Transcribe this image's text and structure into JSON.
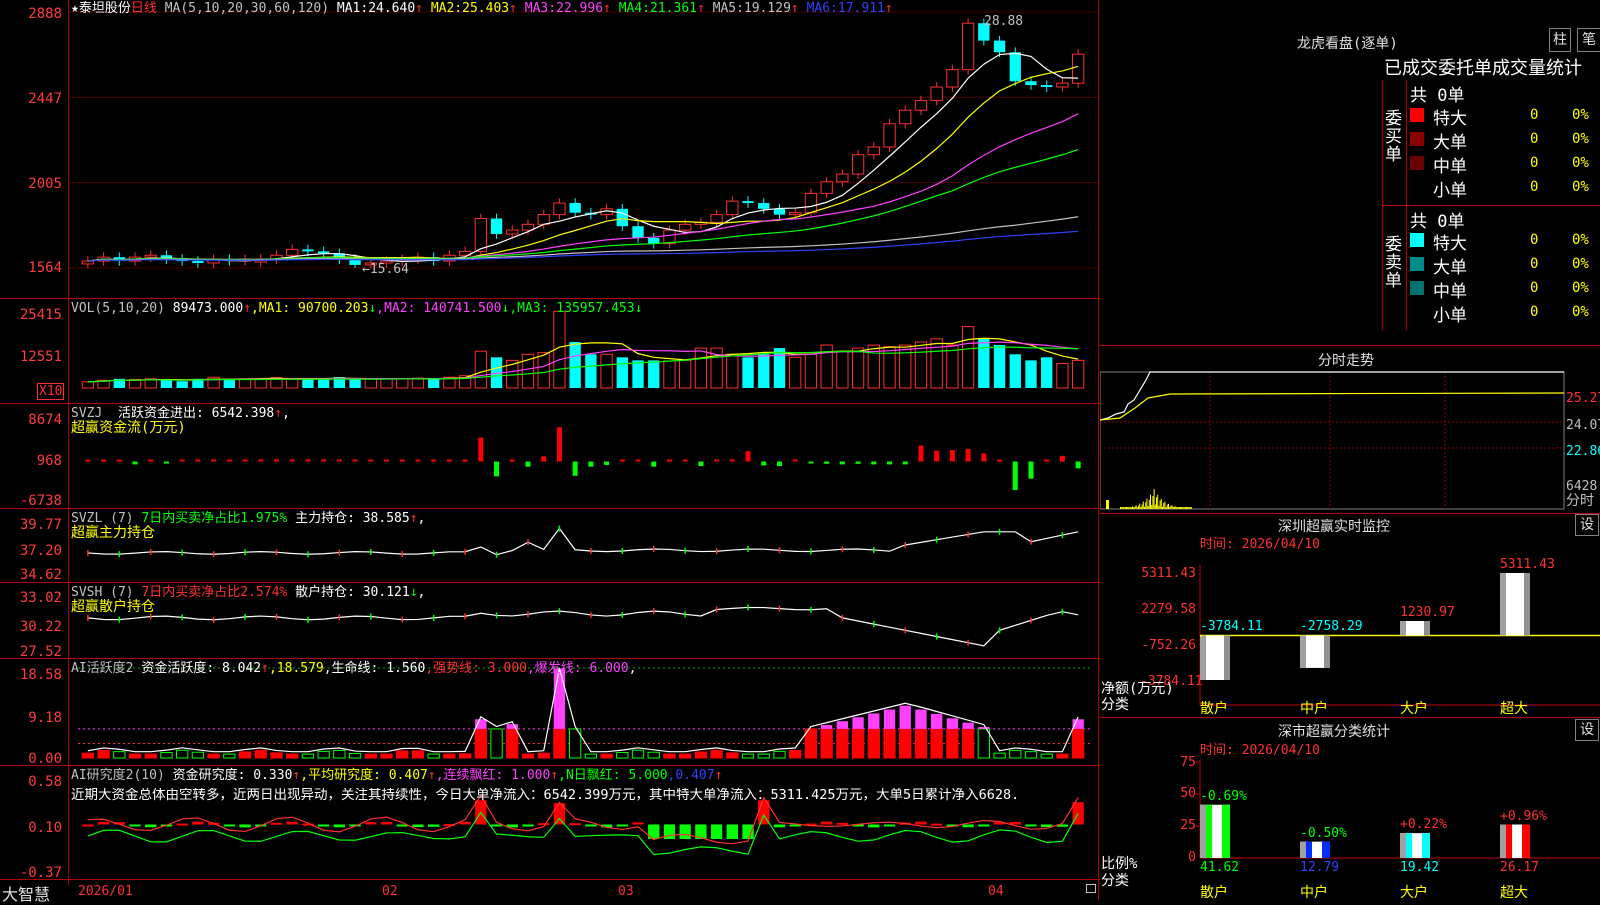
{
  "main": {
    "star": "★",
    "stock_name": "泰坦股份",
    "period": "日线",
    "ma_label": "MA(5,10,20,30,60,120)",
    "ma": [
      {
        "name": "MA1:",
        "value": "24.640",
        "arrow": "↑",
        "color": "#ffffff"
      },
      {
        "name": "MA2:",
        "value": "25.403",
        "arrow": "↑",
        "color": "#ffff00"
      },
      {
        "name": "MA3:",
        "value": "22.996",
        "arrow": "↑",
        "color": "#ff40ff"
      },
      {
        "name": "MA4:",
        "value": "21.361",
        "arrow": "↑",
        "color": "#00ff00"
      },
      {
        "name": "MA5:",
        "value": "19.129",
        "arrow": "↑",
        "color": "#c0c0c0"
      },
      {
        "name": "MA6:",
        "value": "17.911",
        "arrow": "↑",
        "color": "#3040ff"
      }
    ],
    "y_ticks": [
      "2888",
      "2447",
      "2005",
      "1564"
    ],
    "high_label": "28.88",
    "low_label": "←15.64"
  },
  "vol": {
    "label": "VOL(5,10,20)",
    "value": "89473.000",
    "arrow": "↑",
    "ma1": "MA1: 90700.203",
    "ma1_arrow": "↓",
    "ma2": "MA2: 140741.500",
    "ma2_arrow": "↓",
    "ma3": "MA3: 135957.453",
    "ma3_arrow": "↓",
    "y_ticks": [
      "25415",
      "12551"
    ],
    "unit": "X10"
  },
  "svzj": {
    "label": "SVZJ",
    "desc": "活跃资金进出: 6542.398",
    "arrow": "↑",
    "comma": ",",
    "subtitle": "超赢资金流(万元)",
    "y_ticks": [
      "8674",
      "968",
      "-6738"
    ]
  },
  "svzl": {
    "label": "SVZL",
    "param": "(7)",
    "desc1": "7日内买卖净占比1.975%",
    "desc2": "主力持仓: 38.585",
    "arrow": "↑",
    "comma": ",",
    "subtitle": "超赢主力持仓",
    "y_ticks": [
      "39.77",
      "37.20",
      "34.62"
    ]
  },
  "svsh": {
    "label": "SVSH",
    "param": "(7)",
    "desc1": "7日内买卖净占比2.574%",
    "desc2": "散户持仓: 30.121",
    "arrow": "↓",
    "comma": ",",
    "subtitle": "超赢散户持仓",
    "y_ticks": [
      "33.02",
      "30.22",
      "27.52"
    ]
  },
  "ai_active": {
    "label": "AI活跃度2",
    "desc": "资金活跃度: 8.042",
    "arrow1": "↑",
    "val2": ",18.579",
    "life": ",生命线: 1.560",
    "strong": ",强势线: 3.000",
    "burst": ",爆发线: 6.000",
    "end": ",",
    "y_ticks": [
      "18.58",
      "9.18",
      "0.00"
    ]
  },
  "ai_research": {
    "label": "AI研究度2(10)",
    "desc": "资金研究度: 0.330",
    "arrow1": "↑",
    "avg": ",平均研究度: 0.407",
    "arrow2": "↑",
    "red1": ",连续飘红: 1.000",
    "arrow3": "↑",
    "red2": ",N日飘红: 5.000",
    "val": ",0.407",
    "arrow4": "↑",
    "comment": "近期大资金总体由空转多，近两日出现异动，关注其持续性，今日大单净流入：6542.399万元，其中特大单净流入：5311.425万元，大单5日累计净入6628.",
    "y_ticks": [
      "0.58",
      "0.10",
      "-0.37"
    ]
  },
  "bottom": {
    "brand": "大智慧",
    "dates": [
      "2026/01",
      "02",
      "03",
      "04"
    ]
  },
  "right": {
    "dragon_title": "龙虎看盘(逐单)",
    "btn_bar": "柱",
    "btn_pen": "笔",
    "header": "已成交委托单成交量统计",
    "buy": {
      "side": "委买单",
      "total": "共 0单",
      "rows": [
        {
          "name": "特大",
          "count": "0",
          "pct": "0%",
          "color": "#ff0000"
        },
        {
          "name": "大单",
          "count": "0",
          "pct": "0%",
          "color": "#8b0000"
        },
        {
          "name": "中单",
          "count": "0",
          "pct": "0%",
          "color": "#6b0000"
        },
        {
          "name": "小单",
          "count": "0",
          "pct": "0%",
          "color": "#000000"
        }
      ]
    },
    "sell": {
      "side": "委卖单",
      "total": "共 0单",
      "rows": [
        {
          "name": "特大",
          "count": "0",
          "pct": "0%",
          "color": "#00ffff"
        },
        {
          "name": "大单",
          "count": "0",
          "pct": "0%",
          "color": "#008b8b"
        },
        {
          "name": "中单",
          "count": "0",
          "pct": "0%",
          "color": "#007070"
        },
        {
          "name": "小单",
          "count": "0",
          "pct": "0%",
          "color": "#000000"
        }
      ]
    },
    "intraday": {
      "title": "分时走势",
      "prices": [
        "25.27",
        "24.07",
        "22.86"
      ],
      "vol_label": "6428",
      "footer": "分时"
    },
    "sz_monitor": {
      "title": "深圳超赢实时监控",
      "btn": "设",
      "time": "时间: 2026/04/10",
      "y_ticks": [
        "5311.43",
        "2279.58",
        "-752.26",
        "-3784.11"
      ],
      "axis_label": "净额(万元)",
      "axis_label2": "分类",
      "categories": [
        "散户",
        "中户",
        "大户",
        "超大"
      ],
      "values": [
        "-3784.11",
        "-2758.29",
        "1230.97",
        "5311.43"
      ]
    },
    "sz_class": {
      "title": "深市超赢分类统计",
      "btn": "设",
      "time": "时间: 2026/04/10",
      "y_ticks": [
        "75",
        "50",
        "25",
        "0"
      ],
      "axis_label": "比例%",
      "axis_label2": "分类",
      "categories": [
        "散户",
        "中户",
        "大户",
        "超大"
      ],
      "pct_change": [
        "-0.69%",
        "-0.50%",
        "+0.22%",
        "+0.96%"
      ],
      "values": [
        "41.62",
        "12.79",
        "19.42",
        "26.17"
      ]
    }
  },
  "chart_data": [
    {
      "type": "candlestick",
      "title": "泰坦股份 日线",
      "ylim": [
        15.64,
        28.88
      ],
      "x_ticks": [
        "2026/01",
        "02",
        "03",
        "04"
      ],
      "close": [
        16.0,
        16.2,
        16.0,
        16.2,
        16.3,
        16.1,
        16.0,
        15.9,
        16.1,
        16.0,
        16.1,
        16.1,
        16.3,
        16.6,
        16.5,
        16.4,
        16.1,
        15.8,
        15.9,
        16.0,
        16.1,
        16.2,
        16.0,
        16.3,
        16.5,
        18.2,
        17.4,
        17.6,
        17.9,
        18.4,
        19.0,
        18.5,
        18.4,
        18.7,
        17.8,
        17.2,
        16.9,
        17.6,
        17.9,
        18.0,
        18.4,
        19.1,
        19.0,
        18.7,
        18.4,
        18.5,
        19.5,
        20.1,
        20.5,
        21.5,
        21.9,
        23.1,
        23.8,
        24.3,
        25.0,
        25.9,
        28.3,
        27.4,
        26.8,
        25.3,
        25.1,
        25.0,
        25.2,
        26.7
      ],
      "ma": {
        "MA1": "24.640",
        "MA2": "25.403",
        "MA3": "22.996",
        "MA4": "21.361",
        "MA5": "19.129",
        "MA6": "17.911"
      }
    },
    {
      "type": "bar",
      "title": "VOL(5,10,20)",
      "ylim": [
        0,
        25415
      ],
      "values": [
        2000,
        2500,
        3000,
        2800,
        3000,
        2500,
        2200,
        3000,
        3500,
        3000,
        3000,
        2800,
        3400,
        3000,
        3200,
        2900,
        3600,
        2800,
        2900,
        3000,
        3000,
        3200,
        3000,
        3500,
        4000,
        12000,
        10000,
        9000,
        11000,
        11500,
        25000,
        15000,
        11000,
        11000,
        10000,
        9000,
        9000,
        8800,
        9000,
        13000,
        13000,
        11000,
        10000,
        11000,
        13000,
        10000,
        11000,
        14000,
        12000,
        13000,
        14000,
        13500,
        14000,
        15000,
        16000,
        14000,
        20000,
        16000,
        14000,
        11000,
        9000,
        10000,
        8000,
        9000
      ],
      "ma": {
        "MA1": "90700.203",
        "MA2": "140741.500",
        "MA3": "135957.453"
      }
    },
    {
      "type": "bar",
      "title": "超赢资金流(万元)",
      "ylim": [
        -6738,
        8674
      ],
      "values": [
        0,
        0,
        0,
        -500,
        0,
        -300,
        0,
        0,
        0,
        0,
        0,
        0,
        0,
        0,
        0,
        0,
        0,
        0,
        0,
        0,
        0,
        0,
        0,
        0,
        0,
        4200,
        -2600,
        0,
        -900,
        900,
        6000,
        -2500,
        -900,
        -600,
        0,
        0,
        -900,
        0,
        0,
        -800,
        0,
        0,
        1800,
        -700,
        -800,
        0,
        -300,
        -400,
        -500,
        -400,
        -500,
        -500,
        -500,
        2800,
        1900,
        2000,
        2200,
        1400,
        0,
        -5000,
        -3000,
        0,
        1000,
        -1200,
        6542
      ]
    },
    {
      "type": "line",
      "title": "超赢主力持仓",
      "ylim": [
        34.62,
        39.77
      ]
    },
    {
      "type": "line",
      "title": "超赢散户持仓",
      "ylim": [
        27.52,
        33.02
      ]
    },
    {
      "type": "bar",
      "title": "AI活跃度2",
      "ylim": [
        0,
        18.58
      ],
      "strong_line": 3.0,
      "burst_line": 6.0
    },
    {
      "type": "bar",
      "title": "AI研究度2(10)",
      "ylim": [
        -0.37,
        0.58
      ]
    },
    {
      "type": "bar",
      "title": "深圳超赢实时监控",
      "categories": [
        "散户",
        "中户",
        "大户",
        "超大"
      ],
      "values": [
        -3784.11,
        -2758.29,
        1230.97,
        5311.43
      ],
      "ylim": [
        -3784.11,
        5311.43
      ]
    },
    {
      "type": "bar",
      "title": "深市超赢分类统计",
      "categories": [
        "散户",
        "中户",
        "大户",
        "超大"
      ],
      "values": [
        41.62,
        12.79,
        19.42,
        26.17
      ],
      "ylim": [
        0,
        75
      ]
    }
  ]
}
